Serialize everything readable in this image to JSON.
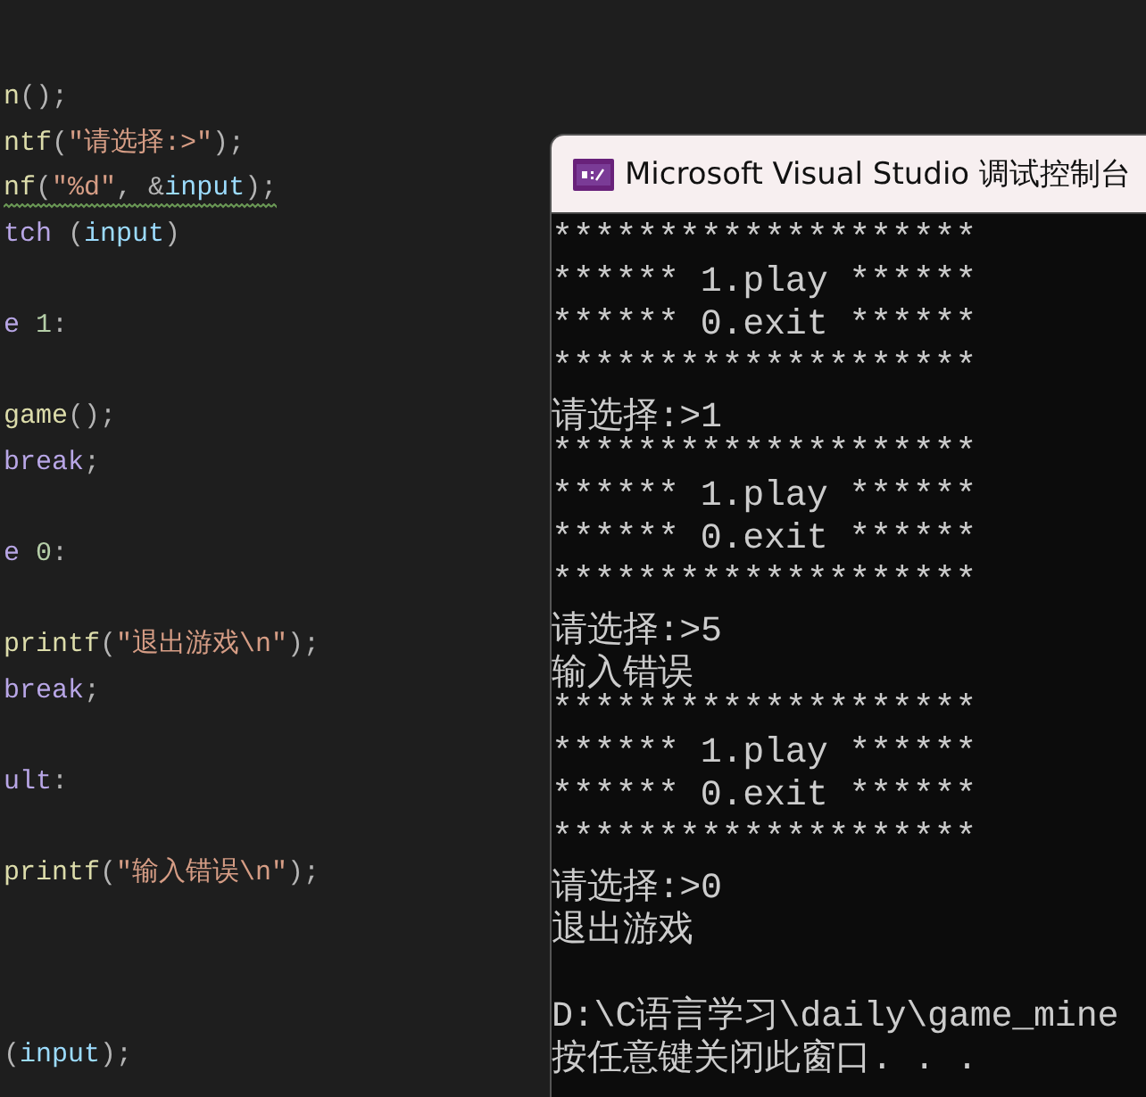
{
  "editor": {
    "lines": [
      {
        "kind": "code",
        "tokens": [
          {
            "kind": "func",
            "text": "n"
          },
          {
            "kind": "punct",
            "text": "();"
          }
        ]
      },
      {
        "kind": "code",
        "tokens": [
          {
            "kind": "func",
            "text": "ntf"
          },
          {
            "kind": "punct",
            "text": "("
          },
          {
            "kind": "string",
            "text": "\"请选择:>\""
          },
          {
            "kind": "punct",
            "text": ");"
          }
        ]
      },
      {
        "kind": "code",
        "squiggle": true,
        "tokens": [
          {
            "kind": "func",
            "text": "nf"
          },
          {
            "kind": "punct",
            "text": "("
          },
          {
            "kind": "string",
            "text": "\"%d\""
          },
          {
            "kind": "punct",
            "text": ", &"
          },
          {
            "kind": "var",
            "text": "input"
          },
          {
            "kind": "punct",
            "text": ");"
          }
        ]
      },
      {
        "kind": "code",
        "tokens": [
          {
            "kind": "keyword",
            "text": "tch"
          },
          {
            "kind": "punct",
            "text": " ("
          },
          {
            "kind": "var",
            "text": "input"
          },
          {
            "kind": "punct",
            "text": ")"
          }
        ]
      },
      {
        "kind": "blank"
      },
      {
        "kind": "code",
        "tokens": [
          {
            "kind": "keyword",
            "text": "e "
          },
          {
            "kind": "number",
            "text": "1"
          },
          {
            "kind": "punct",
            "text": ":"
          }
        ]
      },
      {
        "kind": "blank"
      },
      {
        "kind": "code",
        "tokens": [
          {
            "kind": "func",
            "text": "game"
          },
          {
            "kind": "punct",
            "text": "();"
          }
        ]
      },
      {
        "kind": "code",
        "tokens": [
          {
            "kind": "keyword",
            "text": "break"
          },
          {
            "kind": "punct",
            "text": ";"
          }
        ]
      },
      {
        "kind": "blank"
      },
      {
        "kind": "code",
        "tokens": [
          {
            "kind": "keyword",
            "text": "e "
          },
          {
            "kind": "number",
            "text": "0"
          },
          {
            "kind": "punct",
            "text": ":"
          }
        ]
      },
      {
        "kind": "blank"
      },
      {
        "kind": "code",
        "tokens": [
          {
            "kind": "func",
            "text": "printf"
          },
          {
            "kind": "punct",
            "text": "("
          },
          {
            "kind": "string",
            "text": "\"退出游戏\\n\""
          },
          {
            "kind": "punct",
            "text": ");"
          }
        ]
      },
      {
        "kind": "code",
        "tokens": [
          {
            "kind": "keyword",
            "text": "break"
          },
          {
            "kind": "punct",
            "text": ";"
          }
        ]
      },
      {
        "kind": "blank"
      },
      {
        "kind": "code",
        "tokens": [
          {
            "kind": "keyword",
            "text": "ult"
          },
          {
            "kind": "punct",
            "text": ":"
          }
        ]
      },
      {
        "kind": "blank"
      },
      {
        "kind": "code",
        "tokens": [
          {
            "kind": "func",
            "text": "printf"
          },
          {
            "kind": "punct",
            "text": "("
          },
          {
            "kind": "string",
            "text": "\"输入错误\\n\""
          },
          {
            "kind": "punct",
            "text": ");"
          }
        ]
      },
      {
        "kind": "blank"
      },
      {
        "kind": "blank"
      },
      {
        "kind": "blank"
      },
      {
        "kind": "code",
        "tokens": [
          {
            "kind": "punct",
            "text": "("
          },
          {
            "kind": "var",
            "text": "input"
          },
          {
            "kind": "punct",
            "text": ");"
          }
        ]
      }
    ]
  },
  "console": {
    "title": "Microsoft Visual Studio 调试控制台",
    "lines": [
      {
        "kind": "text",
        "text": "********************"
      },
      {
        "kind": "text",
        "text": "****** 1.play ******"
      },
      {
        "kind": "text",
        "text": "****** 0.exit ******"
      },
      {
        "kind": "text",
        "text": "********************"
      },
      {
        "kind": "text",
        "text": "请选择:>1"
      },
      {
        "kind": "text",
        "text": "********************"
      },
      {
        "kind": "text",
        "text": "****** 1.play ******"
      },
      {
        "kind": "text",
        "text": "****** 0.exit ******"
      },
      {
        "kind": "text",
        "text": "********************"
      },
      {
        "kind": "text",
        "text": "请选择:>5"
      },
      {
        "kind": "text",
        "text": "输入错误"
      },
      {
        "kind": "text",
        "text": "********************"
      },
      {
        "kind": "text",
        "text": "****** 1.play ******"
      },
      {
        "kind": "text",
        "text": "****** 0.exit ******"
      },
      {
        "kind": "text",
        "text": "********************"
      },
      {
        "kind": "text",
        "text": "请选择:>0"
      },
      {
        "kind": "text",
        "text": "退出游戏"
      },
      {
        "kind": "blank"
      },
      {
        "kind": "text",
        "text": "D:\\C语言学习\\daily\\game_mine"
      },
      {
        "kind": "text",
        "text": "按任意键关闭此窗口. . ."
      }
    ]
  }
}
